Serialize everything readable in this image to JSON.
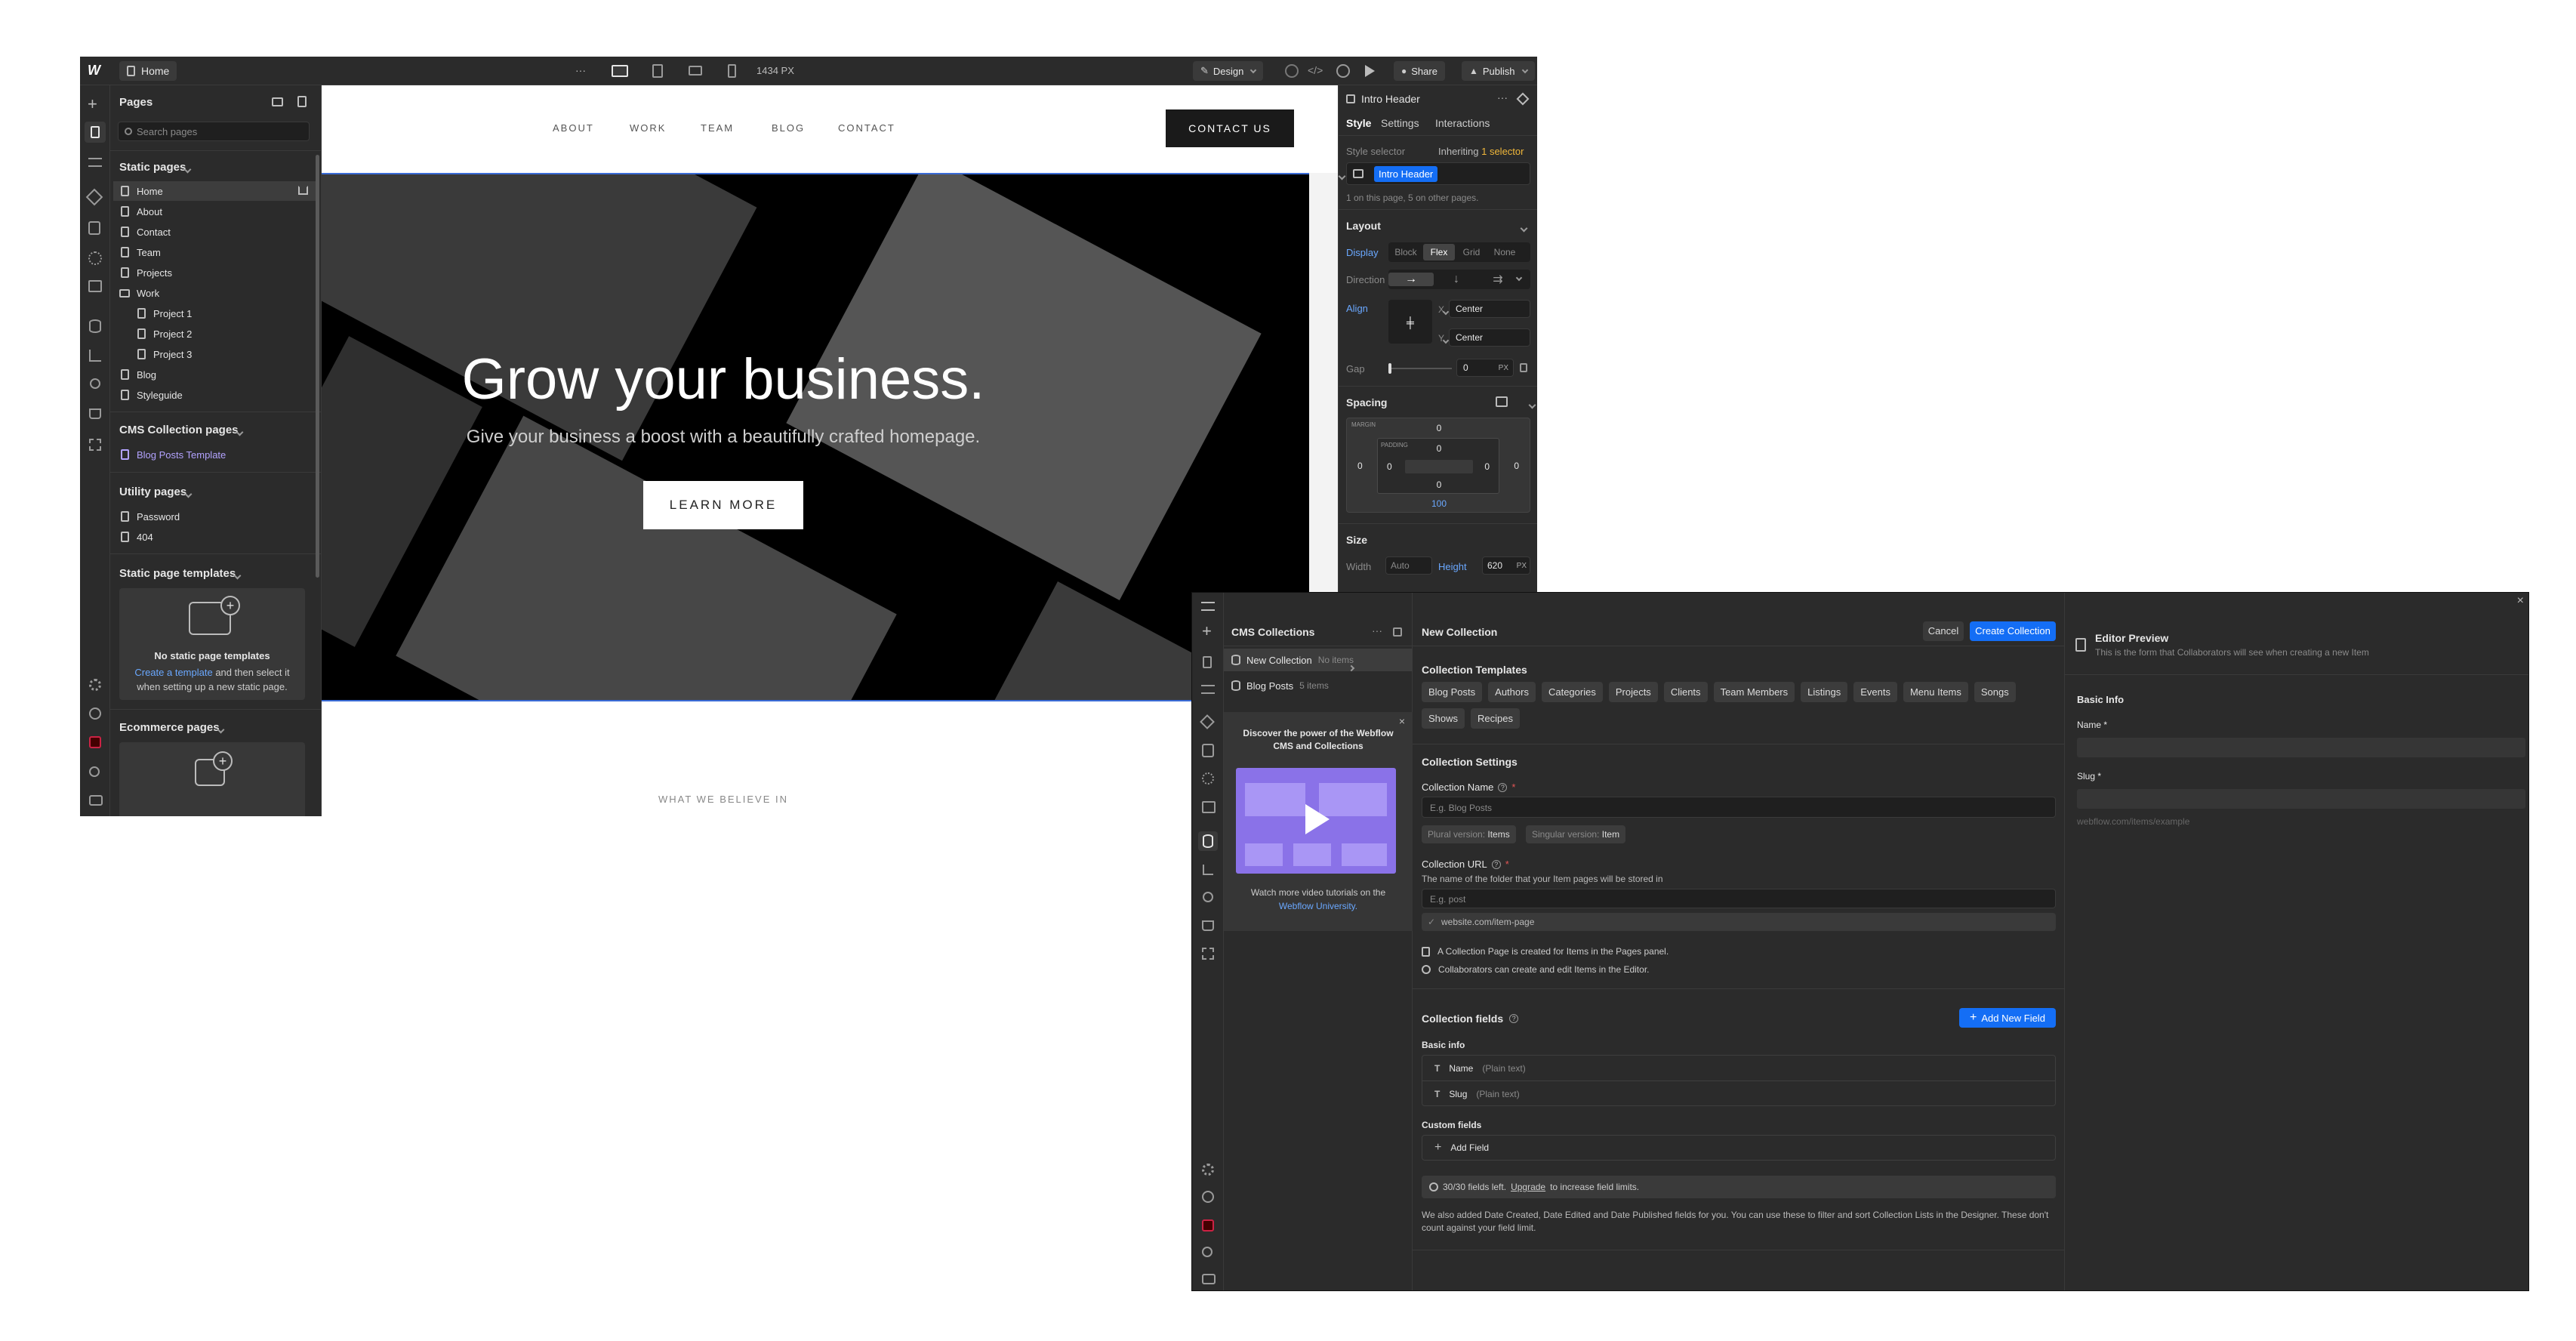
{
  "designer": {
    "logo": "W",
    "page_tab": "Home",
    "more": "···",
    "width_readout": "1434 PX",
    "mode": "Design",
    "share": "Share",
    "publish": "Publish",
    "pages_panel": {
      "title": "Pages",
      "search_placeholder": "Search pages",
      "static_title": "Static pages",
      "static_pages": [
        "Home",
        "About",
        "Contact",
        "Team",
        "Projects",
        "Work",
        "Project 1",
        "Project 2",
        "Project 3",
        "Blog",
        "Styleguide"
      ],
      "cms_title": "CMS Collection pages",
      "cms_pages": [
        "Blog Posts Template"
      ],
      "utility_title": "Utility pages",
      "utility_pages": [
        "Password",
        "404"
      ],
      "templates_title": "Static page templates",
      "templates_empty_title": "No static page templates",
      "templates_link": "Create a template",
      "templates_text": "and then select it when setting up a new static page.",
      "ecommerce_title": "Ecommerce pages"
    },
    "canvas": {
      "nav": [
        "ABOUT",
        "WORK",
        "TEAM",
        "BLOG",
        "CONTACT"
      ],
      "cta": "CONTACT US",
      "hero_title": "Grow your business.",
      "hero_subtitle": "Give your business a boost with a beautifully crafted homepage.",
      "hero_button": "LEARN MORE",
      "next_section": "WHAT WE BELIEVE IN"
    },
    "style_panel": {
      "element": "Intro Header",
      "tabs": [
        "Style",
        "Settings",
        "Interactions"
      ],
      "selector_label": "Style selector",
      "inheriting": "Inheriting",
      "inheriting_count": "1 selector",
      "class_name": "Intro Header",
      "usage": "1 on this page, 5 on other pages.",
      "layout_title": "Layout",
      "display_label": "Display",
      "display_options": [
        "Block",
        "Flex",
        "Grid",
        "None"
      ],
      "direction_label": "Direction",
      "align_label": "Align",
      "x_label": "X",
      "x_value": "Center",
      "y_label": "Y",
      "y_value": "Center",
      "gap_label": "Gap",
      "gap_value": "0",
      "gap_unit": "PX",
      "spacing_title": "Spacing",
      "margin_label": "MARGIN",
      "padding_label": "PADDING",
      "margin_top": "0",
      "margin_left": "0",
      "margin_right": "0",
      "padding_top": "0",
      "padding_left": "0",
      "padding_right": "0",
      "padding_bottom": "0",
      "margin_bottom": "100",
      "size_title": "Size",
      "width_label": "Width",
      "width_value": "Auto",
      "height_label": "Height",
      "height_value": "620",
      "height_unit": "PX"
    }
  },
  "cms": {
    "collections_title": "CMS Collections",
    "collections": [
      {
        "name": "New Collection",
        "count": "No items"
      },
      {
        "name": "Blog Posts",
        "count": "5 items"
      }
    ],
    "promo_title": "Discover the power of the Webflow CMS and Collections",
    "promo_footer": "Watch more video tutorials on the",
    "promo_link": "Webflow University.",
    "form_title": "New Collection",
    "cancel": "Cancel",
    "create": "Create Collection",
    "templates_title": "Collection Templates",
    "templates": [
      "Blog Posts",
      "Authors",
      "Categories",
      "Projects",
      "Clients",
      "Team Members",
      "Listings",
      "Events",
      "Menu Items",
      "Songs",
      "Shows",
      "Recipes"
    ],
    "settings_title": "Collection Settings",
    "name_label": "Collection Name",
    "name_placeholder": "E.g. Blog Posts",
    "plural_label": "Plural version:",
    "plural_value": "Items",
    "singular_label": "Singular version:",
    "singular_value": "Item",
    "url_label": "Collection URL",
    "url_help": "The name of the folder that your Item pages will be stored in",
    "url_placeholder": "E.g. post",
    "url_preview": "website.com/item-page",
    "note1": "A Collection Page is created for Items in the Pages panel.",
    "note2": "Collaborators can create and edit Items in the Editor.",
    "fields_title": "Collection fields",
    "add_field_btn": "Add New Field",
    "basic_info": "Basic info",
    "fields": [
      {
        "name": "Name",
        "type": "(Plain text)"
      },
      {
        "name": "Slug",
        "type": "(Plain text)"
      }
    ],
    "custom_fields": "Custom fields",
    "add_field": "Add Field",
    "limit_text": "30/30 fields left.",
    "limit_link": "Upgrade",
    "limit_rest": "to increase field limits.",
    "footnote": "We also added Date Created, Date Edited and Date Published fields for you. You can use these to filter and sort Collection Lists in the Designer. These don't count against your field limit.",
    "preview_title": "Editor Preview",
    "preview_sub": "This is the form that Collaborators will see when creating a new Item",
    "preview_section": "Basic Info",
    "preview_name": "Name *",
    "preview_slug": "Slug *",
    "preview_slug_hint": "webflow.com/items/example"
  },
  "colors": {
    "accent": "#146ef5",
    "panel": "#2b2b2b",
    "dark": "#1e1e1e"
  }
}
